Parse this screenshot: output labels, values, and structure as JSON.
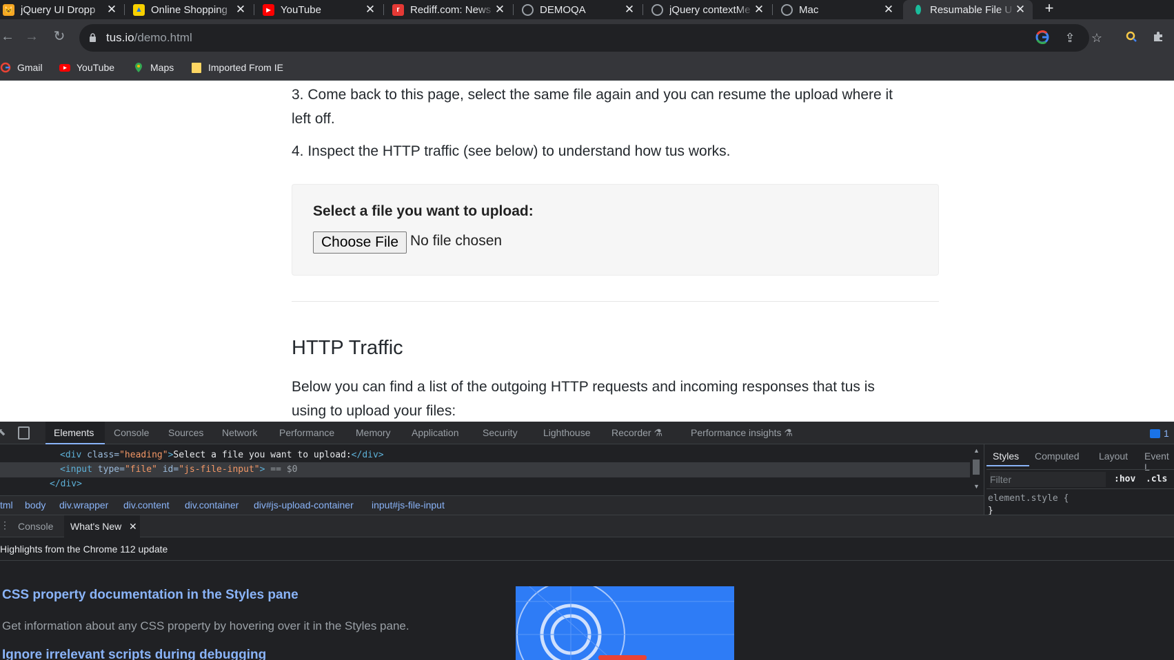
{
  "browser": {
    "tabs": [
      {
        "title": "jQuery UI Dropp",
        "color": "#f5a623",
        "glyph": "😺"
      },
      {
        "title": "Online Shopping",
        "color": "#f7d000",
        "glyph": "🛍"
      },
      {
        "title": "YouTube",
        "color": "#ff0000",
        "glyph": "▶"
      },
      {
        "title": "Rediff.com: News",
        "color": "#e53935",
        "glyph": "r"
      },
      {
        "title": "DEMOQA",
        "color": "#5f6368",
        "glyph": "◍"
      },
      {
        "title": "jQuery contextMe",
        "color": "#5f6368",
        "glyph": "◍"
      },
      {
        "title": "Mac",
        "color": "#5f6368",
        "glyph": "◍"
      },
      {
        "title": "Resumable File U",
        "color": "#1abc9c",
        "glyph": "▮"
      }
    ],
    "new_tab_label": "+",
    "url_host": "tus.io",
    "url_path": "/demo.html",
    "bookmarks": [
      {
        "label": "Gmail",
        "icon": "google-icon"
      },
      {
        "label": "YouTube",
        "icon": "youtube-icon"
      },
      {
        "label": "Maps",
        "icon": "maps-icon"
      },
      {
        "label": "Imported From IE",
        "icon": "folder-icon"
      }
    ]
  },
  "page": {
    "step3": "3. Come back to this page, select the same file again and you can resume the upload where it",
    "step3_cont": "left off.",
    "step4": "4. Inspect the HTTP traffic (see below) to understand how tus works.",
    "upload_heading": "Select a file you want to upload:",
    "choose_file_label": "Choose File",
    "no_file_text": "No file chosen",
    "section_title": "HTTP Traffic",
    "section_body_1": "Below you can find a list of the outgoing HTTP requests and incoming responses that tus is",
    "section_body_2": "using to upload your files:"
  },
  "devtools": {
    "tabs": [
      "Elements",
      "Console",
      "Sources",
      "Network",
      "Performance",
      "Memory",
      "Application",
      "Security",
      "Lighthouse",
      "Recorder",
      "Performance insights"
    ],
    "issues_count": "1",
    "code": {
      "line1_open": "<div",
      "line1_attr": " class=",
      "line1_val": "\"heading\"",
      "line1_text": "Select a file you want to upload:",
      "line1_close": "</div>",
      "line2_open": "<input",
      "line2_attr1": " type=",
      "line2_val1": "\"file\"",
      "line2_attr2": " id=",
      "line2_val2": "\"js-file-input\"",
      "line2_close": ">",
      "line2_marker": " == $0",
      "line3": "</div>"
    },
    "breadcrumbs": [
      "tml",
      "body",
      "div.wrapper",
      "div.content",
      "div.container",
      "div#js-upload-container",
      "input#js-file-input"
    ],
    "styles_tabs": [
      "Styles",
      "Computed",
      "Layout",
      "Event L"
    ],
    "filter_placeholder": "Filter",
    "hov_label": ":hov",
    "cls_label": ".cls",
    "element_style": "element.style {",
    "element_style_close": "}",
    "drawer_tabs": [
      "Console",
      "What's New"
    ],
    "highlights_text": "Highlights from the Chrome 112 update",
    "whats_new": [
      {
        "title": "CSS property documentation in the Styles pane",
        "desc": "Get information about any CSS property by hovering over it in the Styles pane."
      },
      {
        "title": "Ignore irrelevant scripts during debugging",
        "desc": ""
      }
    ]
  },
  "colors": {
    "chrome_dark": "#202124",
    "toolbar": "#35363a",
    "link_blue": "#8ab4f8",
    "promo_blue": "#2e7cf6"
  }
}
